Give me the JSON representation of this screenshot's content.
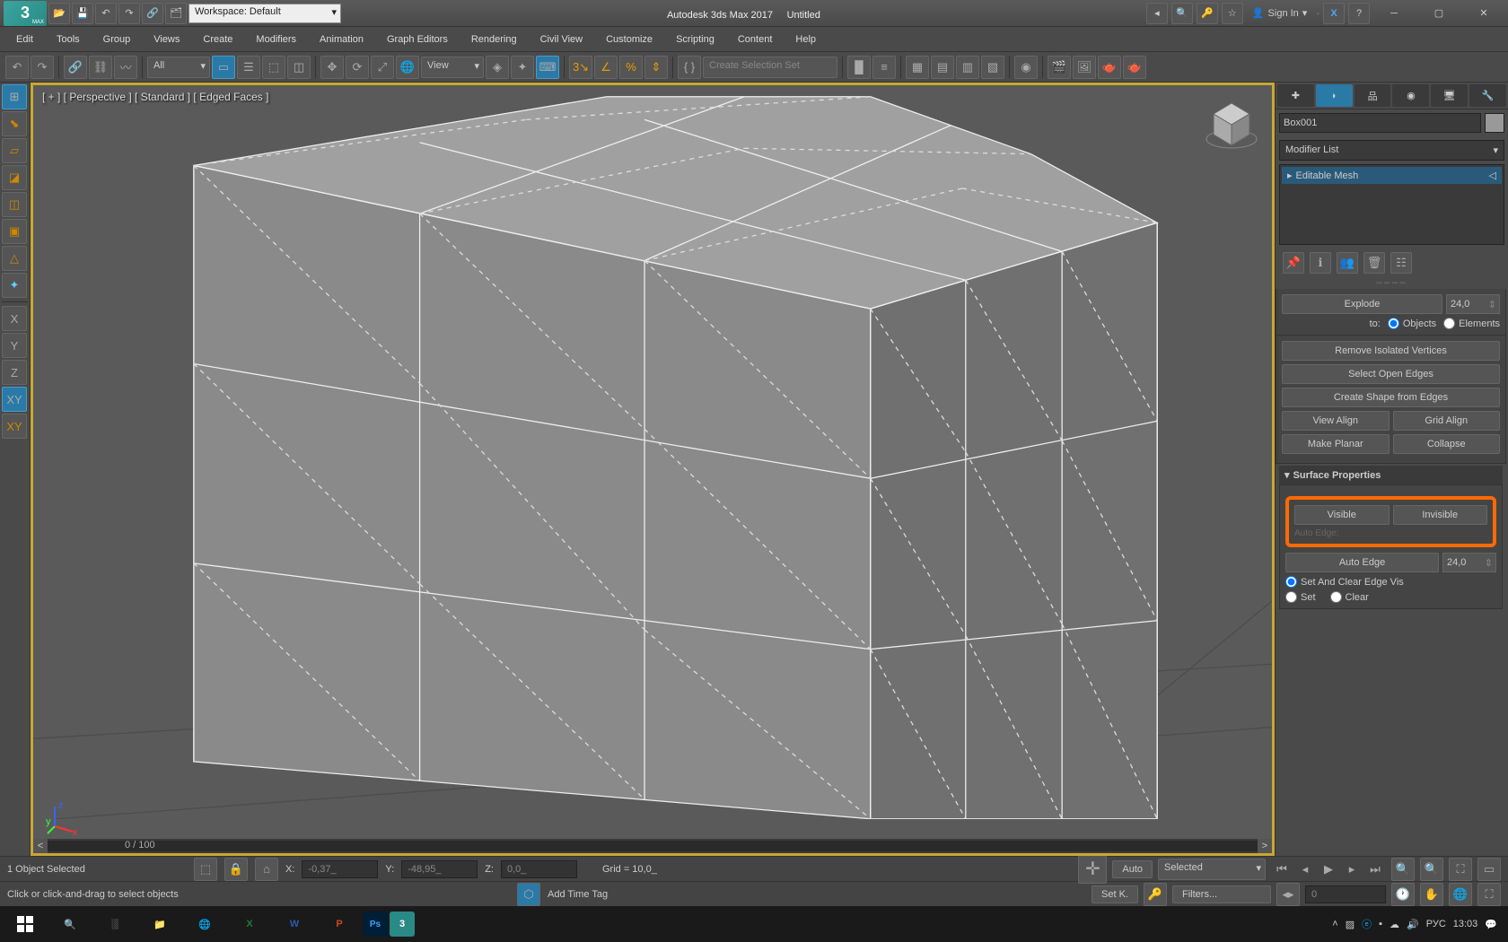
{
  "title": {
    "workspace": "Workspace: Default",
    "app": "Autodesk 3ds Max 2017",
    "doc": "Untitled",
    "signin": "Sign In"
  },
  "menu": [
    "Edit",
    "Tools",
    "Group",
    "Views",
    "Create",
    "Modifiers",
    "Animation",
    "Graph Editors",
    "Rendering",
    "Civil View",
    "Customize",
    "Scripting",
    "Content",
    "Help"
  ],
  "toolbar": {
    "filter": "All",
    "ref": "View",
    "selset": "Create Selection Set"
  },
  "left_axis": {
    "x": "X",
    "y": "Y",
    "z": "Z",
    "xy": "XY",
    "xy2": "XY"
  },
  "viewport": {
    "label": "[ + ] [ Perspective ] [ Standard ] [ Edged Faces ]",
    "slider": "0 / 100"
  },
  "rightpanel": {
    "objname": "Box001",
    "modlist_label": "Modifier List",
    "moditem": "Editable Mesh",
    "explode": {
      "label": "Explode",
      "value": "24,0",
      "to": "to:",
      "objects": "Objects",
      "elements": "Elements"
    },
    "buttons": {
      "remove_iso": "Remove Isolated Vertices",
      "select_open": "Select Open Edges",
      "create_shape": "Create Shape from Edges",
      "view_align": "View Align",
      "grid_align": "Grid Align",
      "make_planar": "Make Planar",
      "collapse": "Collapse"
    },
    "surface": {
      "header": "Surface Properties",
      "visible": "Visible",
      "invisible": "Invisible",
      "auto_edge_hidden": "Auto Edge",
      "auto_edge": "Auto Edge",
      "auto_val": "24,0",
      "set_clear": "Set And Clear Edge Vis",
      "set": "Set",
      "clear": "Clear"
    }
  },
  "status": {
    "selected": "1 Object Selected",
    "x_label": "X:",
    "x": "-0,37_",
    "y_label": "Y:",
    "y": "-48,95_",
    "z_label": "Z:",
    "z": "0,0_",
    "grid": "Grid = 10,0_",
    "addtime": "Add Time Tag",
    "auto": "Auto",
    "setk": "Set K.",
    "selected2": "Selected",
    "filters": "Filters...",
    "frame": "0",
    "hint": "Click or click-and-drag to select objects"
  },
  "taskbar": {
    "lang": "РУС",
    "time": "13:03"
  }
}
